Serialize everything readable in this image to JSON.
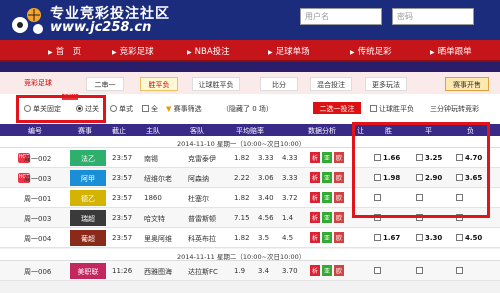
{
  "header": {
    "title": "专业竞彩投注社区",
    "url": "www.jc258.cn",
    "username_placeholder": "用户名",
    "password_placeholder": "密码",
    "login_label": "登录",
    "register_label": "注册"
  },
  "nav": [
    {
      "label": "首　页"
    },
    {
      "label": "竞彩足球"
    },
    {
      "label": "NBA投注"
    },
    {
      "label": "足球单场"
    },
    {
      "label": "传统足彩"
    },
    {
      "label": "晒单跟单"
    }
  ],
  "tabs": {
    "brand": "竞彩足球",
    "items": [
      "二串一",
      "胜平负",
      "让球胜平负",
      "比分",
      "混合投注",
      "更多玩法"
    ],
    "rules_button": "赛事开售"
  },
  "filters": {
    "single_fixed": "单关固定",
    "hot_badge": "NEW",
    "pass": "过关",
    "single": "单式",
    "all": "全",
    "filter": "赛事筛选",
    "hidden": "（隐藏了 0 场）",
    "two_choose_one": "二选一投注",
    "let_spf": "让球胜平负",
    "three_min": "三分钟玩转竞彩"
  },
  "table_header": {
    "no": "编号",
    "match": "赛事",
    "deadline": "截止",
    "home": "主队",
    "away": "客队",
    "avg_odds": "平均赔率",
    "analysis": "数据分析",
    "let": "让",
    "win": "胜",
    "draw": "平",
    "lose": "负"
  },
  "date_groups": [
    {
      "label": "2014-11-10 星期一（10:00~次日10:00）"
    },
    {
      "label": "2014-11-11 星期二（10:00~次日10:00）"
    }
  ],
  "rows": [
    {
      "no": "周一002",
      "league": "法乙",
      "league_color": "#2eaf6e",
      "time": "23:57",
      "home": "南锡",
      "away": "克雷泰伊",
      "o1": "1.82",
      "o2": "3.33",
      "o3": "4.33",
      "win": "1.66",
      "draw": "3.25",
      "lose": "4.70",
      "hot": true,
      "actions": [
        "析",
        "亚",
        "欧"
      ]
    },
    {
      "no": "周一003",
      "league": "阿甲",
      "league_color": "#1a8fd6",
      "time": "23:57",
      "home": "纽维尔老",
      "away": "阿森纳",
      "o1": "2.22",
      "o2": "3.06",
      "o3": "3.33",
      "win": "1.98",
      "draw": "2.90",
      "lose": "3.65",
      "hot": true,
      "actions": [
        "析",
        "亚",
        "欧"
      ]
    },
    {
      "no": "周一001",
      "league": "德乙",
      "league_color": "#d4b400",
      "time": "23:57",
      "home": "1860",
      "away": "杜塞尔",
      "o1": "1.82",
      "o2": "3.40",
      "o3": "3.72",
      "win": "",
      "draw": "",
      "lose": "",
      "hot": false,
      "actions": [
        "析",
        "亚",
        "欧"
      ]
    },
    {
      "no": "周一003",
      "league": "瑞超",
      "league_color": "#3a3a3a",
      "time": "23:57",
      "home": "哈文特",
      "away": "普雷斯顿",
      "o1": "7.15",
      "o2": "4.56",
      "o3": "1.4",
      "win": "",
      "draw": "",
      "lose": "",
      "hot": false,
      "actions": [
        "析",
        "亚",
        "欧"
      ]
    },
    {
      "no": "周一004",
      "league": "葡超",
      "league_color": "#8a2a1a",
      "time": "23:57",
      "home": "里奥阿维",
      "away": "科英布拉",
      "o1": "1.82",
      "o2": "3.5",
      "o3": "4.5",
      "win": "1.67",
      "draw": "3.30",
      "lose": "4.50",
      "hot": false,
      "actions": [
        "析",
        "亚",
        "欧"
      ]
    },
    {
      "no": "周一006",
      "league": "美职联",
      "league_color": "#c2275e",
      "time": "11:26",
      "home": "西雅图海",
      "away": "达拉斯FC",
      "o1": "1.9",
      "o2": "3.4",
      "o3": "3.70",
      "win": "",
      "draw": "",
      "lose": "",
      "hot": false,
      "actions": [
        "析",
        "亚",
        "欧"
      ]
    }
  ]
}
